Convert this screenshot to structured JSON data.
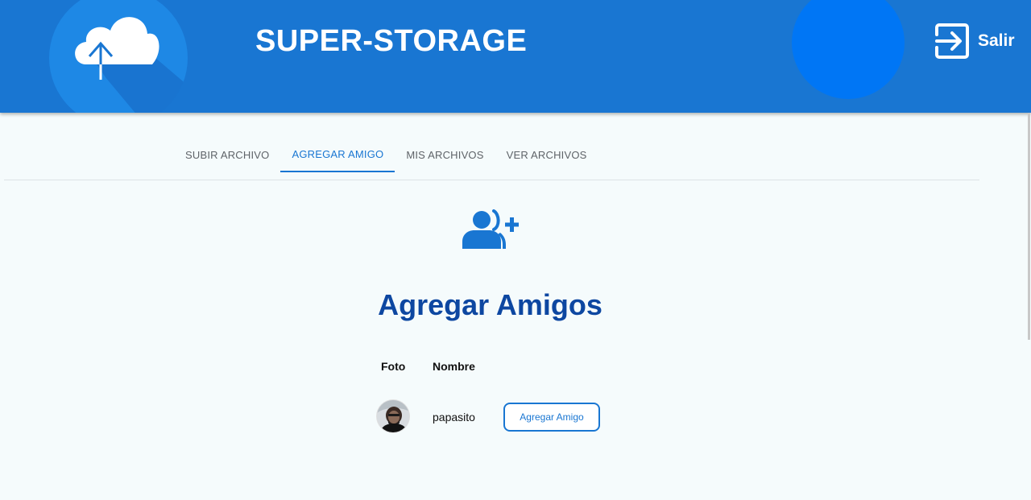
{
  "header": {
    "title": "SUPER-STORAGE",
    "logo_icon": "cloud-upload-icon",
    "logout_label": "Salir",
    "logout_icon": "exit-icon",
    "colors": {
      "bar": "#1976d2",
      "logo_circle": "#1e88e5",
      "deco_circle": "#0076f5"
    }
  },
  "tabs": [
    {
      "label": "SUBIR ARCHIVO",
      "active": false
    },
    {
      "label": "AGREGAR AMIGO",
      "active": true
    },
    {
      "label": "MIS ARCHIVOS",
      "active": false
    },
    {
      "label": "VER ARCHIVOS",
      "active": false
    }
  ],
  "main": {
    "icon": "add-friend-icon",
    "heading": "Agregar Amigos",
    "table": {
      "headers": [
        "Foto",
        "Nombre"
      ],
      "rows": [
        {
          "name": "papasito",
          "action_label": "Agregar Amigo"
        }
      ]
    }
  },
  "colors": {
    "accent": "#1976d2",
    "heading": "#0d47a1",
    "background": "#f5fbfc"
  }
}
